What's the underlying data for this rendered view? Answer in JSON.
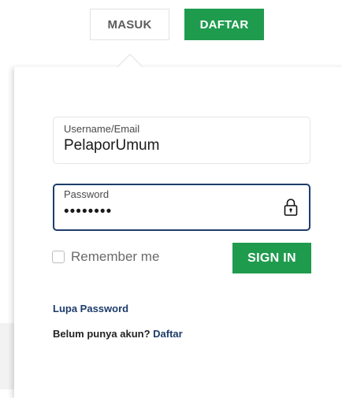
{
  "tabs": {
    "masuk_label": "MASUK",
    "daftar_label": "DAFTAR"
  },
  "form": {
    "username": {
      "label": "Username/Email",
      "value": "PelaporUmum"
    },
    "password": {
      "label": "Password",
      "value": "••••••••",
      "icon": "lock-icon"
    },
    "remember_label": "Remember me",
    "remember_checked": false,
    "signin_label": "SIGN IN",
    "forgot_label": "Lupa Password",
    "no_account_text": "Belum punya akun?",
    "register_link": "Daftar"
  },
  "colors": {
    "green": "#1f9b4e",
    "navy": "#1d3c6b"
  }
}
